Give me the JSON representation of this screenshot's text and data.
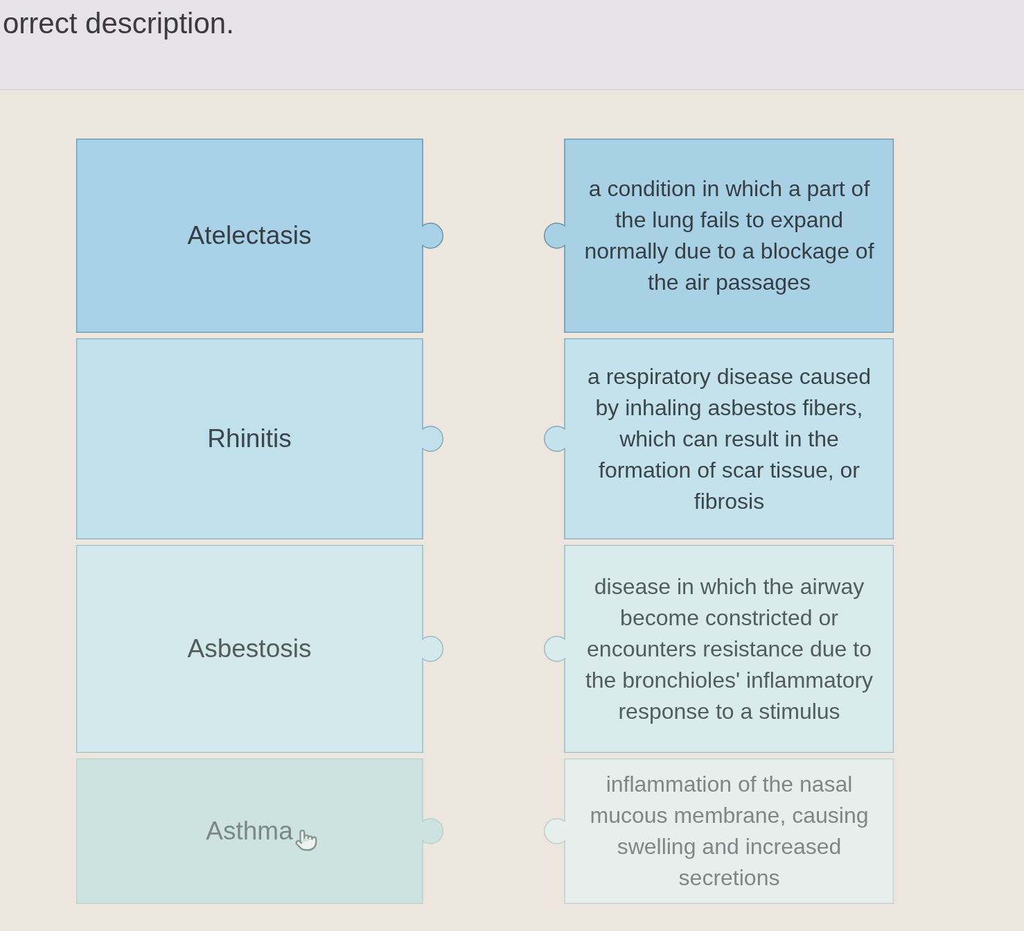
{
  "instruction": "orrect description.",
  "terms": [
    {
      "label": "Atelectasis",
      "hovered": false
    },
    {
      "label": "Rhinitis",
      "hovered": false
    },
    {
      "label": "Asbestosis",
      "hovered": false
    },
    {
      "label": "Asthma",
      "hovered": true
    }
  ],
  "descriptions": [
    "a condition in which a part of the lung fails to expand normally due to a blockage of the air passages",
    "a respiratory disease caused by inhaling asbestos fibers, which can result in the formation of scar tissue, or fibrosis",
    "disease in which the airway become constricted or encounters resistance due to the bronchioles' inflammatory response to a stimulus",
    "inflammation of the nasal mucous membrane, causing swelling and increased secretions"
  ]
}
